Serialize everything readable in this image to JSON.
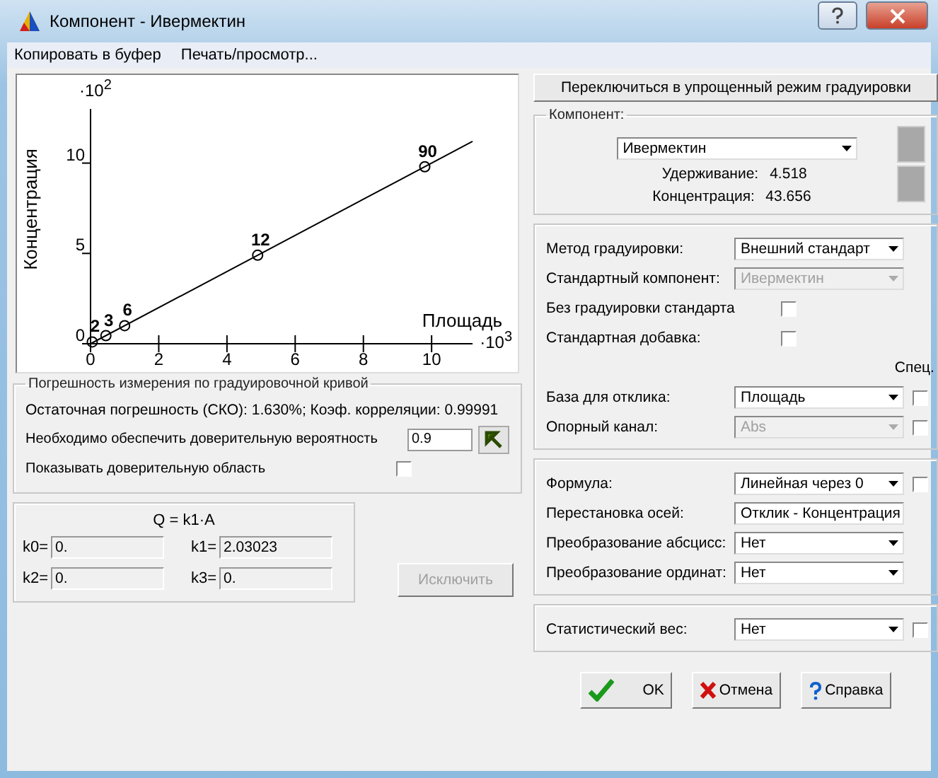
{
  "window": {
    "title": "Компонент - Ивермектин"
  },
  "menu": [
    {
      "label": "Копировать в буфер"
    },
    {
      "label": "Печать/просмотр..."
    }
  ],
  "chart": {
    "x_multiplier": "·10$^{3}$",
    "y_multiplier": "·10$^{2}$",
    "chart_data": {
      "type": "scatter",
      "xlabel": "Площадь",
      "ylabel": "Концентрация",
      "x": [
        0.05,
        0.45,
        1.0,
        4.9,
        9.8
      ],
      "series": [
        {
          "color": "#000000",
          "values": [
            0.1,
            0.45,
            1.0,
            4.9,
            9.8
          ]
        }
      ],
      "xlim": [
        0,
        11.2
      ],
      "ylim": [
        0,
        13
      ],
      "xticks": [
        0,
        2,
        4,
        6,
        8,
        10
      ],
      "yticks": [
        0,
        5,
        10
      ],
      "annotations": [
        {
          "x": 0.05,
          "y": 0.1,
          "text": "2"
        },
        {
          "x": 0.45,
          "y": 0.45,
          "text": "3"
        },
        {
          "x": 1.0,
          "y": 1.0,
          "text": "6"
        },
        {
          "x": 4.9,
          "y": 4.9,
          "text": "12"
        },
        {
          "x": 9.8,
          "y": 9.8,
          "text": "90"
        }
      ]
    }
  },
  "error_group": {
    "title": "Погрешность измерения по градуировочной кривой",
    "residual_text": "Остаточная погрешность (СКО): 1.630%;  Коэф. корреляции: 0.99991",
    "confidence_label": "Необходимо обеспечить доверительную вероятность",
    "confidence_value": "0.9",
    "show_region_label": "Показывать доверительную область",
    "show_region_checked": false
  },
  "coefficients": {
    "formula": "Q = k1·A",
    "items": [
      {
        "label": "k0=",
        "value": "0."
      },
      {
        "label": "k1=",
        "value": "2.03023"
      },
      {
        "label": "k2=",
        "value": "0."
      },
      {
        "label": "k3=",
        "value": "0."
      }
    ],
    "exclude_button": {
      "label": "Исключить",
      "disabled": true
    }
  },
  "simplified_button": {
    "label": "Переключиться в упрощенный режим градуировки"
  },
  "component": {
    "legend": "Компонент:",
    "value": "Ивермектин",
    "retention_label": "Удерживание:",
    "retention_value": "4.518",
    "concentration_label": "Концентрация:",
    "concentration_value": "43.656"
  },
  "settings_groups": [
    {
      "rows": [
        {
          "kind": "select",
          "label": "Метод градуировки:",
          "value": "Внешний стандарт",
          "disabled": false
        },
        {
          "kind": "select",
          "label": "Стандартный компонент:",
          "value": "Ивермектин",
          "disabled": true
        },
        {
          "kind": "checkbox",
          "label": "Без градуировки стандарта",
          "checked": false
        },
        {
          "kind": "checkbox",
          "label": "Стандартная добавка:",
          "checked": false
        },
        {
          "kind": "header",
          "label": "Спец."
        },
        {
          "kind": "select",
          "label": "База для отклика:",
          "value": "Площадь",
          "disabled": false,
          "spec_checked": false
        },
        {
          "kind": "select",
          "label": "Опорный канал:",
          "value": "Abs",
          "disabled": true,
          "spec_checked": false
        }
      ]
    },
    {
      "rows": [
        {
          "kind": "select",
          "label": "Формула:",
          "value": "Линейная через 0",
          "disabled": false,
          "spec_checked": false
        },
        {
          "kind": "select",
          "label": "Перестановка осей:",
          "value": "Отклик - Концентрация",
          "disabled": false
        },
        {
          "kind": "select",
          "label": "Преобразование абсцисс:",
          "value": "Нет",
          "disabled": false
        },
        {
          "kind": "select",
          "label": "Преобразование ординат:",
          "value": "Нет",
          "disabled": false
        }
      ]
    },
    {
      "rows": [
        {
          "kind": "select",
          "label": "Статистический вес:",
          "value": "Нет",
          "disabled": false,
          "spec_checked": false
        }
      ]
    }
  ],
  "buttons": [
    {
      "kind": "ok",
      "label": "OK"
    },
    {
      "kind": "cancel",
      "label": "Отмена"
    },
    {
      "kind": "help",
      "label": "Справка"
    }
  ]
}
